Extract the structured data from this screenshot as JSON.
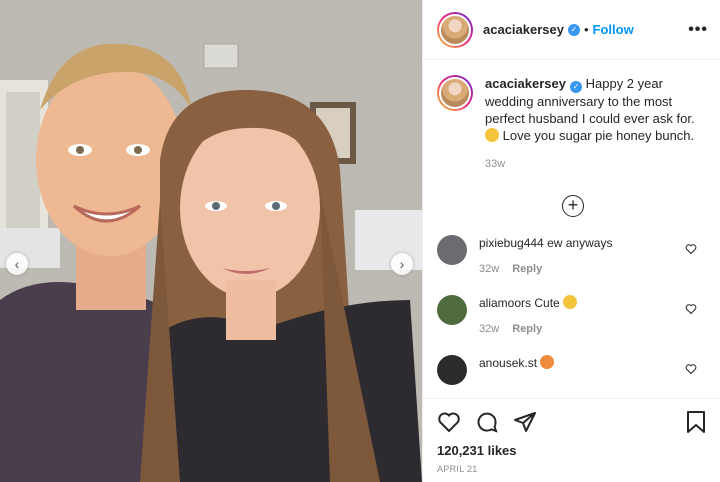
{
  "post": {
    "username": "acaciakersey",
    "follow_label": "Follow",
    "separator": "•",
    "more_label": "•••",
    "caption_text": "Happy 2 year wedding anniversary to the most perfect husband I could ever ask for.",
    "caption_text_end": "Love you sugar pie honey bunch.",
    "caption_time": "33w",
    "load_more_label": "+",
    "likes": "120,231 likes",
    "date": "APRIL 21"
  },
  "comments": [
    {
      "username": "pixiebug444",
      "text": "ew anyways",
      "time": "32w",
      "reply": "Reply",
      "avatar_color": "#6e6a72"
    },
    {
      "username": "aliamoors",
      "text": "Cute",
      "time": "32w",
      "reply": "Reply",
      "avatar_color": "#4f6b3e"
    },
    {
      "username": "anousek.st",
      "text": "",
      "time": "",
      "reply": "",
      "avatar_color": "#2c2c2c"
    }
  ],
  "icons": {
    "like": "heart-icon",
    "comment": "comment-icon",
    "share": "share-icon",
    "save": "bookmark-icon",
    "verified": "verified-badge-icon",
    "photo_prev": "chevron-left-icon",
    "photo_next": "chevron-right-icon",
    "caption_emoji": "emoji-icon",
    "comment_emoji": "smiling-emoji-icon",
    "heart_eyes_emoji": "heart-eyes-emoji-icon"
  },
  "colors": {
    "accent": "#0095f6",
    "verified": "#3897f0",
    "muted": "#8e8e8e",
    "text": "#262626"
  }
}
